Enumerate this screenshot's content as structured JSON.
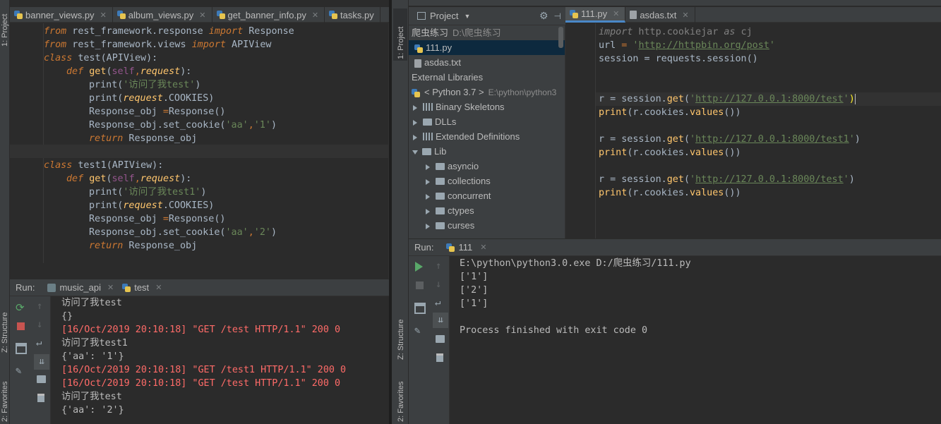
{
  "left": {
    "sidebar": {
      "project_label": "1: Project",
      "structure_label": "Z: Structure",
      "favorites_label": "2: Favorites"
    },
    "tabs": [
      "banner_views.py",
      "album_views.py",
      "get_banner_info.py",
      "tasks.py"
    ],
    "code": {
      "l1_kw": "from",
      "l1_mod": " rest_framework.response ",
      "l1_imp": "import",
      "l1_name": " Response",
      "l2_kw": "from",
      "l2_mod": " rest_framework.views ",
      "l2_imp": "import",
      "l2_name": " APIView",
      "l3_kw": "class",
      "l3_name": " test",
      "l3_base": "(APIView):",
      "l4_kw": "def",
      "l4_fn": " get",
      "l4_open": "(",
      "l4_self": "self",
      "l4_comma": ",",
      "l4_param": "request",
      "l4_close": "):",
      "l5_print": "print(",
      "l5_str": "'访问了我test'",
      "l5_close": ")",
      "l6_print": "print(",
      "l6_param": "request",
      "l6_rest": ".COOKIES)",
      "l7_var": "Response_obj ",
      "l7_eq": "=",
      "l7_call": "Response()",
      "l8_call": "Response_obj.set_cookie(",
      "l8_a": "'aa'",
      "l8_comma": ",",
      "l8_b": "'1'",
      "l8_close": ")",
      "l9_kw": "return",
      "l9_val": " Response_obj",
      "l11_kw": "class",
      "l11_name": " test1",
      "l11_base": "(APIView):",
      "l12_kw": "def",
      "l12_fn": " get",
      "l12_open": "(",
      "l12_self": "self",
      "l12_comma": ",",
      "l12_param": "request",
      "l12_close": "):",
      "l13_print": "print(",
      "l13_str": "'访问了我test1'",
      "l13_close": ")",
      "l14_print": "print(",
      "l14_param": "request",
      "l14_rest": ".COOKIES)",
      "l15_var": "Response_obj ",
      "l15_eq": "=",
      "l15_call": "Response()",
      "l16_call": "Response_obj.set_cookie(",
      "l16_a": "'aa'",
      "l16_comma": ",",
      "l16_b": "'2'",
      "l16_close": ")",
      "l17_kw": "return",
      "l17_val": " Response_obj"
    },
    "run": {
      "label": "Run:",
      "tabs": [
        "music_api",
        "test"
      ],
      "output": [
        {
          "text": "访问了我test",
          "red": false
        },
        {
          "text": "{}",
          "red": false
        },
        {
          "text": "[16/Oct/2019 20:10:18] \"GET /test HTTP/1.1\" 200 0",
          "red": true
        },
        {
          "text": "访问了我test1",
          "red": false
        },
        {
          "text": "{'aa': '1'}",
          "red": false
        },
        {
          "text": "[16/Oct/2019 20:10:18] \"GET /test1 HTTP/1.1\" 200 0",
          "red": true
        },
        {
          "text": "[16/Oct/2019 20:10:18] \"GET /test HTTP/1.1\" 200 0",
          "red": true
        },
        {
          "text": "访问了我test",
          "red": false
        },
        {
          "text": "{'aa': '2'}",
          "red": false
        }
      ]
    }
  },
  "right": {
    "sidebar": {
      "project_label": "1: Project",
      "structure_label": "Z: Structure",
      "favorites_label": "2: Favorites"
    },
    "project": {
      "title": "Project",
      "root_name": "爬虫练习",
      "root_path": "D:\\爬虫练习",
      "items": {
        "f1": "111.py",
        "f2": "asdas.txt",
        "ext": "External Libraries",
        "py": "< Python 3.7 >",
        "py_path": "E:\\python\\python3",
        "bin": "Binary Skeletons",
        "dlls": "DLLs",
        "extdef": "Extended Definitions",
        "lib": "Lib",
        "asyncio": "asyncio",
        "collections": "collections",
        "concurrent": "concurrent",
        "ctypes": "ctypes",
        "curses": "curses"
      }
    },
    "tabs": [
      "111.py",
      "asdas.txt"
    ],
    "code": {
      "l1_kw": "import",
      "l1_rest": " http.cookiejar ",
      "l1_as": "as",
      "l1_cj": " cj",
      "l2_a": "url ",
      "l2_eq": "=",
      "l2_sp": " ",
      "l2_q1": "'",
      "l2_url": "http://httpbin.org/post",
      "l2_q2": "'",
      "l3": "session = requests.session()",
      "l6_a": "r = session.",
      "l6_get": "get",
      "l6_p": "(",
      "l6_q1": "'",
      "l6_url": "http://127.0.0.1:8000/test",
      "l6_q2": "'",
      "l6_c": ")",
      "l7_a": "print",
      "l7_b": "(r.cookies.",
      "l7_v": "values",
      "l7_c": "())",
      "l9_a": "r = session.",
      "l9_get": "get",
      "l9_p": "(",
      "l9_q1": "'",
      "l9_url": "http://127.0.0.1:8000/test1",
      "l9_q2": "'",
      "l9_c": ")",
      "l10_a": "print",
      "l10_b": "(r.cookies.",
      "l10_v": "values",
      "l10_c": "())",
      "l12_a": "r = session.",
      "l12_get": "get",
      "l12_p": "(",
      "l12_q1": "'",
      "l12_url": "http://127.0.0.1:8000/test",
      "l12_q2": "'",
      "l12_c": ")",
      "l13_a": "print",
      "l13_b": "(r.cookies.",
      "l13_v": "values",
      "l13_c": "())"
    },
    "run": {
      "label": "Run:",
      "tab": "111",
      "output": [
        "E:\\python\\python3.0.exe D:/爬虫练习/111.py",
        "['1']",
        "['2']",
        "['1']",
        "",
        "Process finished with exit code 0"
      ]
    }
  },
  "colors": {
    "keyword": "#cc7832",
    "string": "#6a8759",
    "function": "#ffc66d",
    "link": "#287bde",
    "error_output": "#ff6b68"
  }
}
